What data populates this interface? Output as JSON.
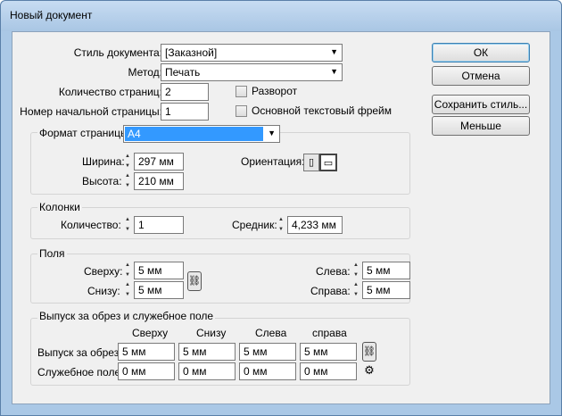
{
  "window": {
    "title": "Новый документ"
  },
  "top": {
    "style_label": "Стиль документа:",
    "style_value": "[Заказной]",
    "method_label": "Метод:",
    "method_value": "Печать",
    "pages_label": "Количество страниц:",
    "pages_value": "2",
    "start_label": "Номер начальной страницы:",
    "start_value": "1",
    "spread_label": "Разворот",
    "master_frame_label": "Основной текстовый фрейм"
  },
  "buttons": {
    "ok": "ОК",
    "cancel": "Отмена",
    "save_style": "Сохранить стиль...",
    "fewer": "Меньше"
  },
  "page_size": {
    "label": "Формат страницы:",
    "value": "A4",
    "width_label": "Ширина:",
    "width_value": "297 мм",
    "height_label": "Высота:",
    "height_value": "210 мм",
    "orientation_label": "Ориентация:"
  },
  "columns": {
    "title": "Колонки",
    "count_label": "Количество:",
    "count_value": "1",
    "gutter_label": "Средник:",
    "gutter_value": "4,233 мм"
  },
  "margins": {
    "title": "Поля",
    "top_label": "Сверху:",
    "top_value": "5 мм",
    "bottom_label": "Снизу:",
    "bottom_value": "5 мм",
    "left_label": "Слева:",
    "left_value": "5 мм",
    "right_label": "Справа:",
    "right_value": "5 мм"
  },
  "bleed": {
    "title": "Выпуск за обрез и служебное поле",
    "headers": [
      "Сверху",
      "Снизу",
      "Слева",
      "справа"
    ],
    "bleed_label": "Выпуск за обрез:",
    "bleed_values": [
      "5 мм",
      "5 мм",
      "5 мм",
      "5 мм"
    ],
    "slug_label": "Служебное поле:",
    "slug_values": [
      "0 мм",
      "0 мм",
      "0 мм",
      "0 мм"
    ]
  },
  "icons": {
    "dropdown": "chevron-down-icon",
    "spinner": "spinner-arrows-icon",
    "link": "chain-link-icon",
    "portrait": "portrait-orientation-icon",
    "landscape": "landscape-orientation-icon"
  }
}
